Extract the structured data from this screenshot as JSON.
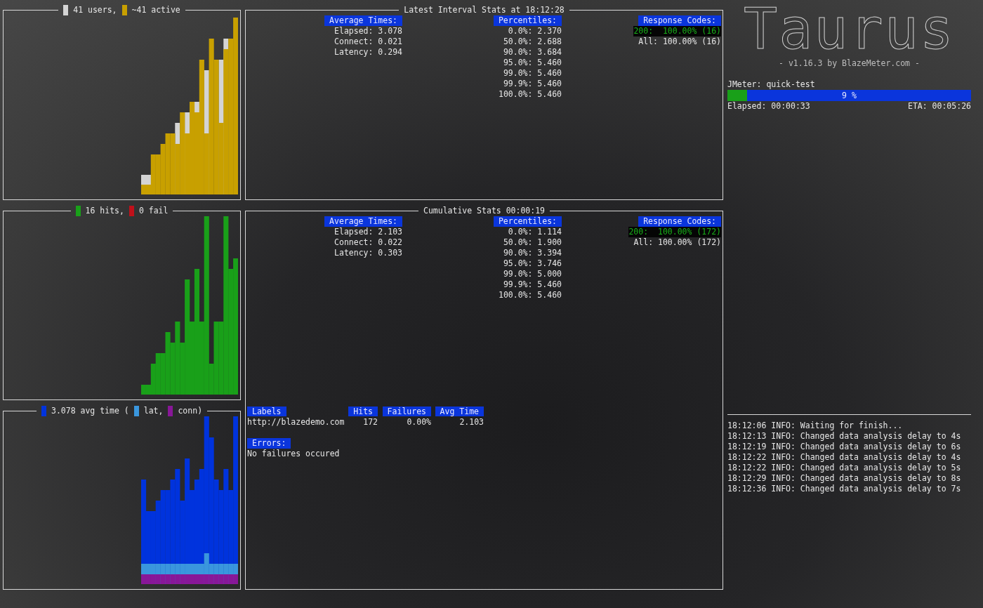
{
  "users_panel": {
    "legend": [
      {
        "label": "41 users,",
        "color": "#d4d4d4"
      },
      {
        "label": "~41 active",
        "color": "#c8a000"
      }
    ]
  },
  "hits_panel": {
    "legend": [
      {
        "label": "16 hits,",
        "color": "#19a019"
      },
      {
        "label": "0 fail",
        "color": "#c0101a"
      }
    ]
  },
  "time_panel": {
    "legend": [
      {
        "label": "3.078 avg time (",
        "color": "#0033dd"
      },
      {
        "label": "lat,",
        "color": "#3a96dd"
      },
      {
        "label": "conn)",
        "color": "#881798"
      }
    ]
  },
  "interval_stats": {
    "title": "Latest Interval Stats at 18:12:28",
    "average_times": {
      "heading": "Average Times:",
      "rows": [
        "Elapsed: 3.078",
        "Connect: 0.021",
        "Latency: 0.294"
      ]
    },
    "percentiles": {
      "heading": "Percentiles:",
      "rows": [
        "0.0%: 2.370",
        "50.0%: 2.688",
        "90.0%: 3.684",
        "95.0%: 5.460",
        "99.0%: 5.460",
        "99.9%: 5.460",
        "100.0%: 5.460"
      ]
    },
    "response_codes": {
      "heading": "Response Codes:",
      "rows": [
        {
          "text": "200:  100.00% (16)",
          "kind": "code"
        },
        {
          "text": "All: 100.00% (16)",
          "kind": "total"
        }
      ]
    }
  },
  "cumulative_stats": {
    "title": "Cumulative Stats 00:00:19",
    "average_times": {
      "heading": "Average Times:",
      "rows": [
        "Elapsed: 2.103",
        "Connect: 0.022",
        "Latency: 0.303"
      ]
    },
    "percentiles": {
      "heading": "Percentiles:",
      "rows": [
        "0.0%: 1.114",
        "50.0%: 1.900",
        "90.0%: 3.394",
        "95.0%: 3.746",
        "99.0%: 5.000",
        "99.9%: 5.460",
        "100.0%: 5.460"
      ]
    },
    "response_codes": {
      "heading": "Response Codes:",
      "rows": [
        {
          "text": "200:  100.00% (172)",
          "kind": "code"
        },
        {
          "text": "All: 100.00% (172)",
          "kind": "total"
        }
      ]
    },
    "labels_table": {
      "columns": [
        "Labels",
        "Hits",
        "Failures",
        "Avg Time"
      ],
      "rows": [
        [
          "http://blazedemo.com",
          "172",
          "0.00%",
          "2.103"
        ]
      ]
    },
    "errors": {
      "heading": "Errors:",
      "text": "No failures occured"
    }
  },
  "logo": {
    "title": "Taurus",
    "subtitle": "- v1.16.3 by BlazeMeter.com -"
  },
  "progress": {
    "label": "JMeter: quick-test",
    "level": 0.08,
    "percent": "9 %",
    "elapsed": "Elapsed: 00:00:33",
    "eta": "ETA: 00:05:26"
  },
  "log": [
    "18:12:06 INFO: Waiting for finish...",
    "18:12:13 INFO: Changed data analysis delay to 4s",
    "18:12:19 INFO: Changed data analysis delay to 6s",
    "18:12:22 INFO: Changed data analysis delay to 4s",
    "18:12:22 INFO: Changed data analysis delay to 5s",
    "18:12:29 INFO: Changed data analysis delay to 8s",
    "18:12:36 INFO: Changed data analysis delay to 7s"
  ]
}
